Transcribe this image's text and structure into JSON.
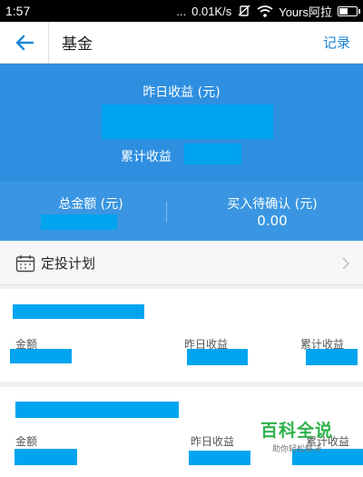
{
  "status_bar": {
    "time": "1:57",
    "speed": "0.01K/s",
    "carrier": "Yours阿拉",
    "signal": "...",
    "battery_level": 0.5
  },
  "header": {
    "title": "基金",
    "records_label": "记录",
    "back_icon": "arrow-left-icon"
  },
  "summary": {
    "yesterday_label": "昨日收益 (元)",
    "cumulative_label": "累计收益"
  },
  "totals": {
    "total_label": "总金额 (元)",
    "pending_label": "买入待确认 (元)",
    "pending_value": "0.00"
  },
  "plan": {
    "label": "定投计划",
    "icon": "calendar-icon"
  },
  "funds": [
    {
      "amount_label": "金额",
      "yesterday_label": "昨日收益",
      "cumulative_label": "累计收益"
    },
    {
      "amount_label": "金额",
      "yesterday_label": "昨日收益",
      "cumulative_label": "累计收益"
    }
  ],
  "watermark": {
    "title": "百科全说",
    "subtitle": "助你轻松解决"
  },
  "colors": {
    "accent": "#1a86d8",
    "banner": "#2e8fe0",
    "redaction": "#00a4ef",
    "watermark": "#2eb24a"
  }
}
